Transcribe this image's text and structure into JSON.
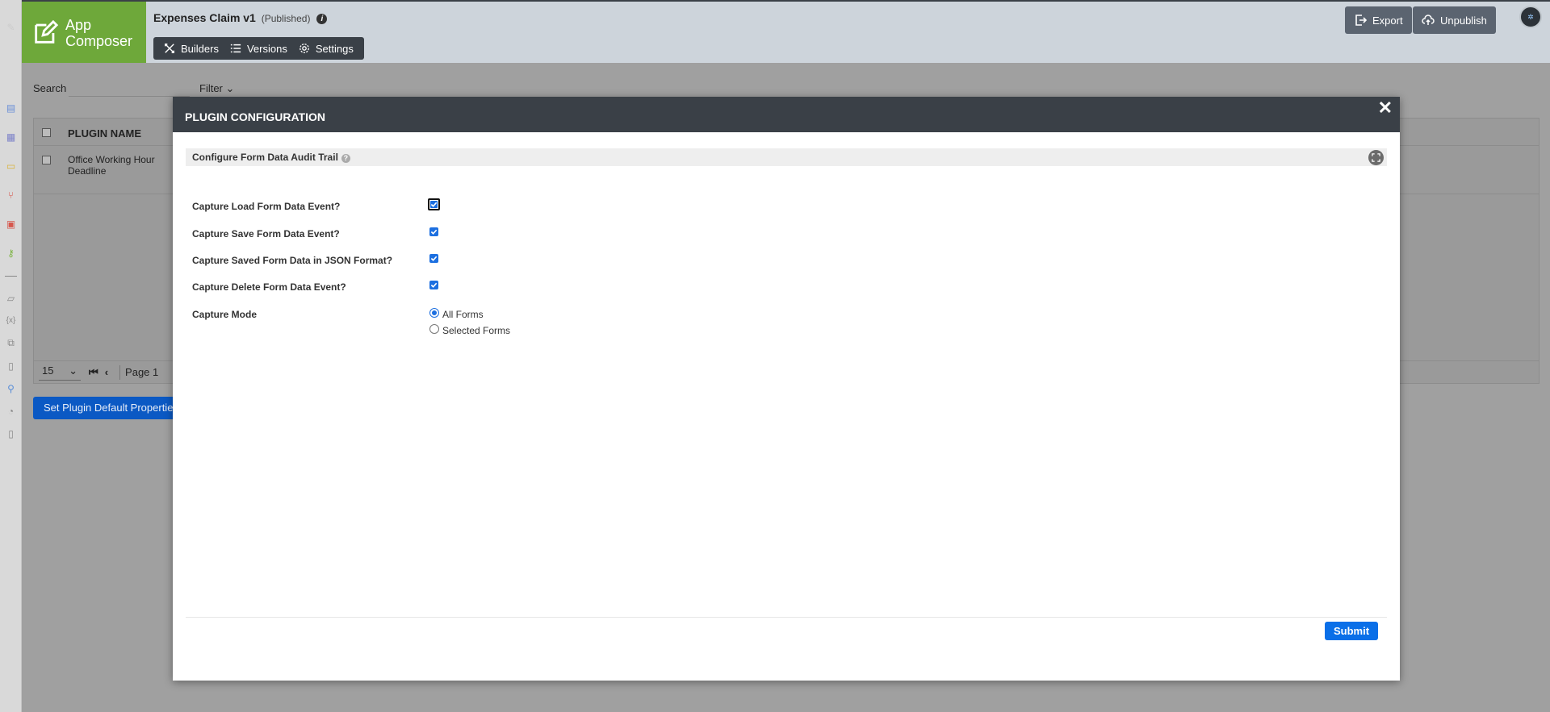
{
  "header": {
    "logo_line1": "App",
    "logo_line2": "Composer",
    "app_name": "Expenses Claim v1",
    "app_status": "(Published)",
    "tabs": [
      {
        "label": "Builders",
        "icon": "builders-icon"
      },
      {
        "label": "Versions",
        "icon": "list-icon"
      },
      {
        "label": "Settings",
        "icon": "gear-icon"
      }
    ],
    "export_label": "Export",
    "unpublish_label": "Unpublish"
  },
  "background": {
    "search_label": "Search",
    "filter_label": "Filter",
    "column_plugin_name": "PLUGIN NAME",
    "row_plugin_name": "Office Working Hour Deadline",
    "page_size": "15",
    "page_label": "Page",
    "page_number": "1",
    "default_props_button": "Set Plugin Default Properties"
  },
  "modal": {
    "title": "PLUGIN CONFIGURATION",
    "section_title": "Configure Form Data Audit Trail",
    "fields": {
      "load": {
        "label": "Capture Load Form Data Event?",
        "checked": true
      },
      "save": {
        "label": "Capture Save Form Data Event?",
        "checked": true
      },
      "json": {
        "label": "Capture Saved Form Data in JSON Format?",
        "checked": true
      },
      "delete": {
        "label": "Capture Delete Form Data Event?",
        "checked": true
      }
    },
    "capture_mode": {
      "label": "Capture Mode",
      "options": [
        "All Forms",
        "Selected Forms"
      ],
      "selected": "All Forms"
    },
    "submit_label": "Submit"
  },
  "colors": {
    "header_dark": "#3a4047",
    "logo_green": "#6ea83a",
    "primary_blue": "#0a6fe8"
  }
}
